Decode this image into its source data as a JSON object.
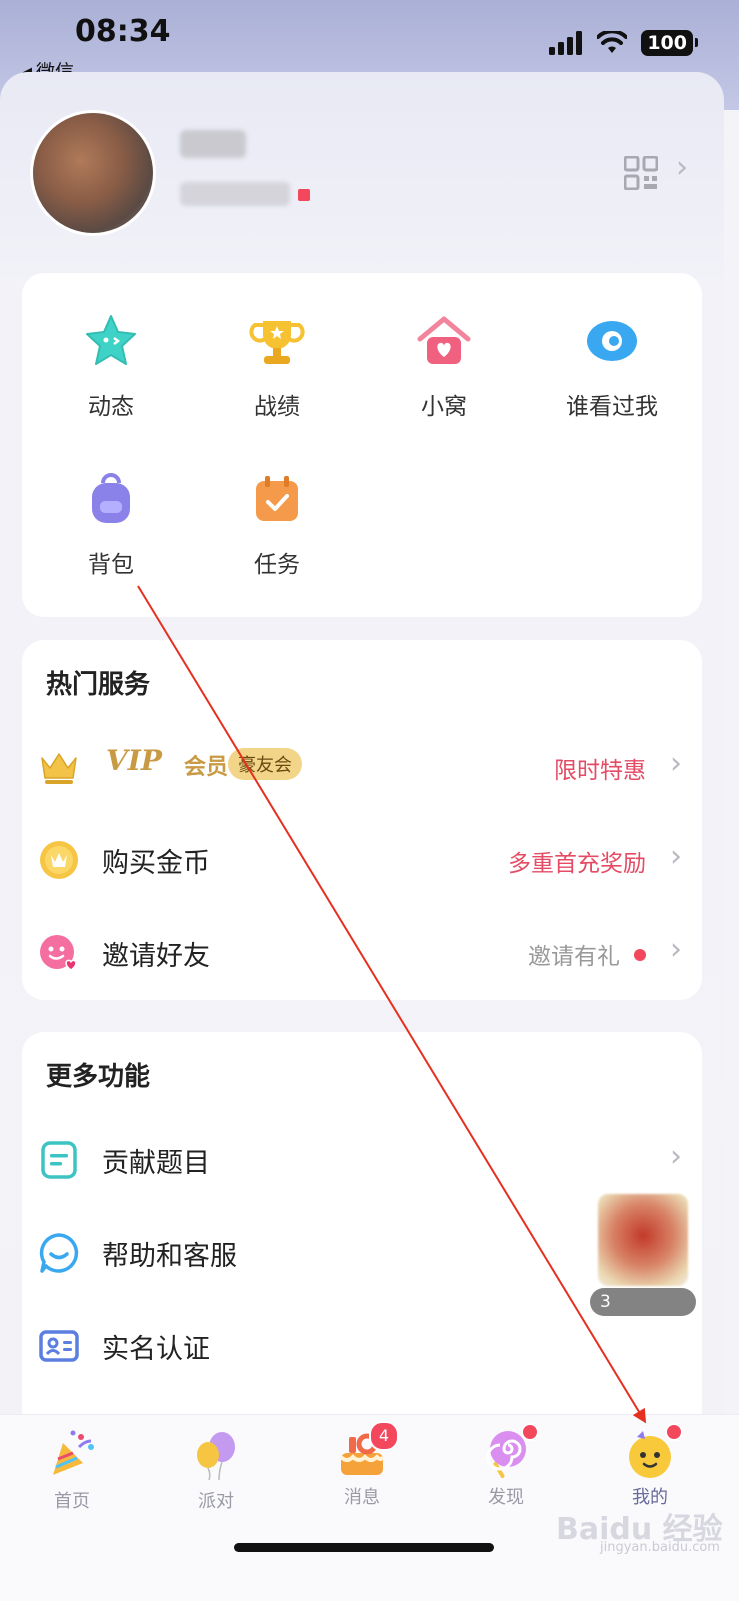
{
  "status": {
    "time": "08:34",
    "back_app": "微信",
    "battery": "100"
  },
  "profile": {
    "qr_icon": "qr-code-icon"
  },
  "quick_grid": [
    {
      "label": "动态",
      "icon": "star-icon"
    },
    {
      "label": "战绩",
      "icon": "trophy-icon"
    },
    {
      "label": "小窝",
      "icon": "house-icon"
    },
    {
      "label": "谁看过我",
      "icon": "eye-icon"
    },
    {
      "label": "背包",
      "icon": "backpack-icon"
    },
    {
      "label": "任务",
      "icon": "calendar-check-icon"
    }
  ],
  "hot_services": {
    "title": "热门服务",
    "vip": {
      "word": "VIP",
      "sub": "会员",
      "badge": "豪友会",
      "right": "限时特惠"
    },
    "coins": {
      "label": "购买金币",
      "right": "多重首充奖励"
    },
    "invite": {
      "label": "邀请好友",
      "right": "邀请有礼"
    }
  },
  "more": {
    "title": "更多功能",
    "items": [
      {
        "label": "贡献题目",
        "icon": "note-icon"
      },
      {
        "label": "帮助和客服",
        "icon": "headset-icon"
      },
      {
        "label": "实名认证",
        "icon": "id-card-icon"
      }
    ]
  },
  "floating_widget": {
    "text": "3"
  },
  "tabs": [
    {
      "label": "首页",
      "icon": "party-popper-icon"
    },
    {
      "label": "派对",
      "icon": "balloons-icon"
    },
    {
      "label": "消息",
      "icon": "cake-icon",
      "badge": "4"
    },
    {
      "label": "发现",
      "icon": "lollipop-icon"
    },
    {
      "label": "我的",
      "icon": "smiley-icon"
    }
  ],
  "watermark": {
    "main": "Baidu 经验",
    "sub": "jingyan.baidu.com"
  },
  "colors": {
    "accent_red": "#e54b64",
    "gold": "#c99a44",
    "annotation_arrow": "#e53020"
  }
}
